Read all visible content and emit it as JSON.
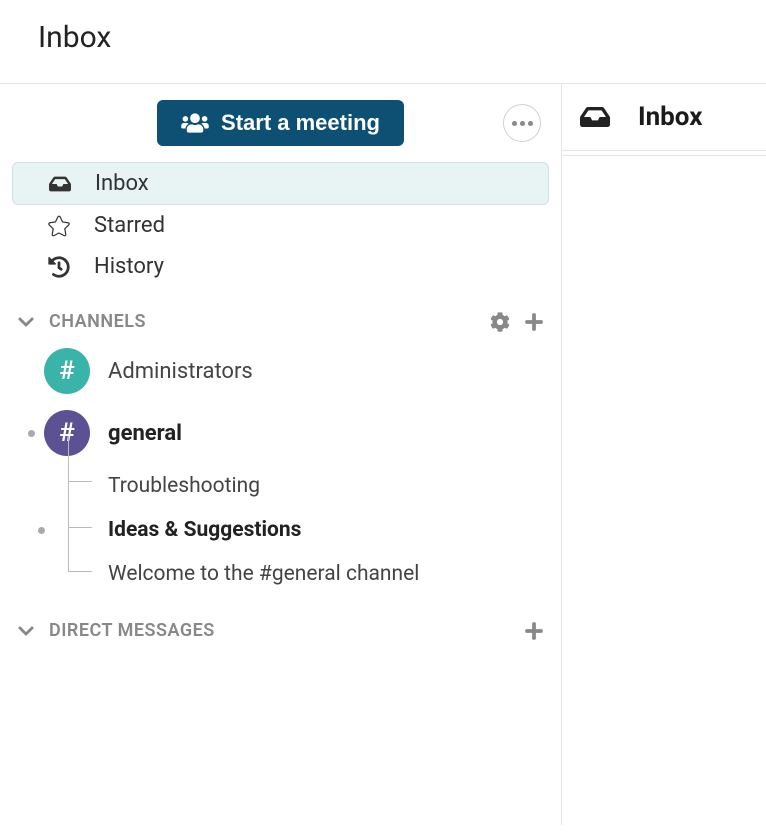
{
  "header": {
    "title": "Inbox"
  },
  "meeting_button": {
    "label": "Start a meeting"
  },
  "nav": {
    "inbox": "Inbox",
    "starred": "Starred",
    "history": "History"
  },
  "sections": {
    "channels": {
      "title": "CHANNELS"
    },
    "direct_messages": {
      "title": "DIRECT MESSAGES"
    }
  },
  "channels": [
    {
      "name": "Administrators",
      "color": "teal",
      "bold": false,
      "unread": false
    },
    {
      "name": "general",
      "color": "purple",
      "bold": true,
      "unread": true
    }
  ],
  "threads": [
    {
      "label": "Troubleshooting",
      "bold": false,
      "unread": false
    },
    {
      "label": "Ideas & Suggestions",
      "bold": true,
      "unread": true
    },
    {
      "label": "Welcome to the #general channel",
      "bold": false,
      "unread": false
    }
  ],
  "main": {
    "title": "Inbox"
  }
}
